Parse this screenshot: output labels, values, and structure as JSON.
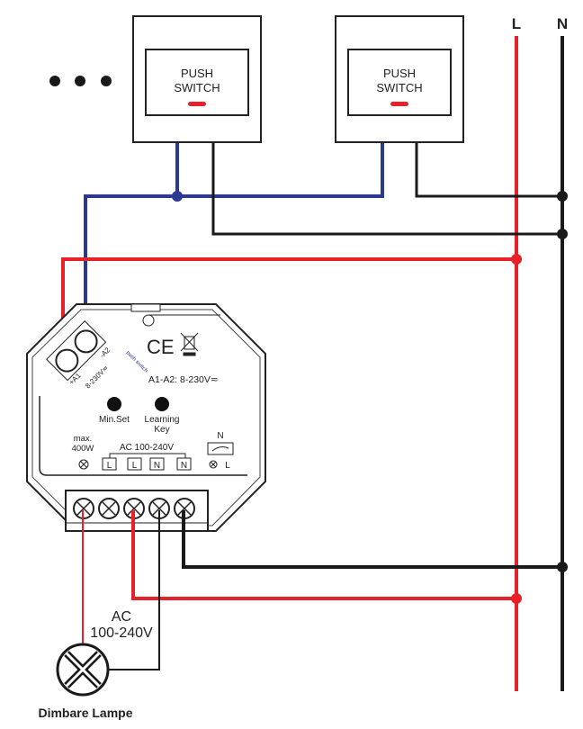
{
  "colors": {
    "live": "#e8202a",
    "neutral": "#1a1a1a",
    "switch_wire": "#2b3990",
    "indicator": "#e8202a"
  },
  "rails": {
    "live_label": "L",
    "neutral_label": "N"
  },
  "switches": [
    {
      "line1": "PUSH",
      "line2": "SWITCH"
    },
    {
      "line1": "PUSH",
      "line2": "SWITCH"
    }
  ],
  "more_indicator": "• • •",
  "module": {
    "ce_mark": "CE",
    "a1_a2_rating": "A1-A2: 8-230V≂",
    "terminal_minus_a2": "-A2",
    "terminal_plus_a1": "+A1",
    "input_voltage": "8-230V≂",
    "push_switch_label": "push switch",
    "min_set_label": "Min.Set",
    "learning_key_label": [
      "Learning",
      "Key"
    ],
    "max_load": [
      "max.",
      "400W"
    ],
    "ac_label": "AC 100-240V",
    "terminals": [
      "L",
      "L",
      "N",
      "N"
    ],
    "dimmer_n": "N",
    "dimmer_l": "L"
  },
  "supply": {
    "line1": "AC",
    "line2": "100-240V"
  },
  "lamp_label": "Dimbare Lampe"
}
